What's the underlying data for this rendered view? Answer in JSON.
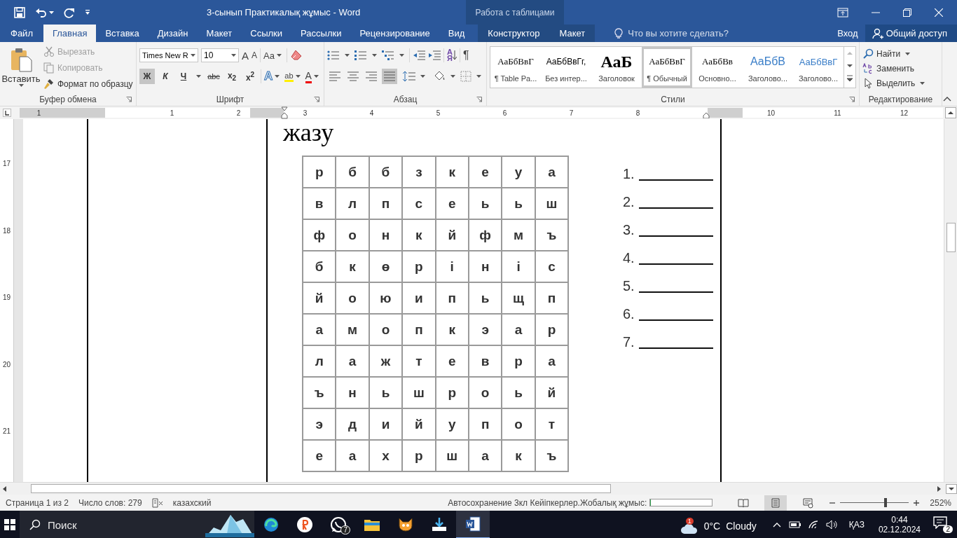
{
  "window": {
    "title": "3-сынып Практикалық жұмыс - Word",
    "context_group": "Работа с таблицами"
  },
  "tabs": [
    {
      "label": "Файл",
      "selected": false,
      "kind": "normal"
    },
    {
      "label": "Главная",
      "selected": true,
      "kind": "normal"
    },
    {
      "label": "Вставка",
      "selected": false,
      "kind": "normal"
    },
    {
      "label": "Дизайн",
      "selected": false,
      "kind": "normal"
    },
    {
      "label": "Макет",
      "selected": false,
      "kind": "normal"
    },
    {
      "label": "Ссылки",
      "selected": false,
      "kind": "normal"
    },
    {
      "label": "Рассылки",
      "selected": false,
      "kind": "normal"
    },
    {
      "label": "Рецензирование",
      "selected": false,
      "kind": "normal"
    },
    {
      "label": "Вид",
      "selected": false,
      "kind": "normal"
    },
    {
      "label": "Конструктор",
      "selected": false,
      "kind": "contextual"
    },
    {
      "label": "Макет",
      "selected": false,
      "kind": "contextual"
    }
  ],
  "tell_me": {
    "placeholder": "Что вы хотите сделать?"
  },
  "account": {
    "sign_in": "Вход",
    "share": "Общий доступ"
  },
  "clipboard": {
    "label": "Буфер обмена",
    "paste": "Вставить",
    "commands": [
      {
        "label": "Вырезать",
        "disabled": true,
        "kind": "cut"
      },
      {
        "label": "Копировать",
        "disabled": true,
        "kind": "copy"
      },
      {
        "label": "Формат по образцу",
        "disabled": false,
        "kind": "painter"
      }
    ]
  },
  "font": {
    "label": "Шрифт",
    "font_name": "Times New R",
    "font_size": "10",
    "grow": "A",
    "shrink": "A",
    "case": "Aa",
    "format_buttons": [
      {
        "label": "Ж",
        "selected": true,
        "kind": "bold"
      },
      {
        "label": "К",
        "selected": false,
        "kind": "italic"
      },
      {
        "label": "Ч",
        "selected": false,
        "kind": "underline"
      },
      {
        "label": "abc",
        "selected": false,
        "kind": "strike"
      },
      {
        "label": "x$_{2}$",
        "selected": false,
        "kind": "sub"
      },
      {
        "label": "x$^{2}$",
        "selected": false,
        "kind": "sup"
      }
    ],
    "effects": "A",
    "highlight": "ab",
    "font_color_letter": "A"
  },
  "paragraph": {
    "label": "Абзац",
    "sort": "АЯ",
    "pilcrow": "¶",
    "alignment": [
      {
        "kind": "left",
        "selected": false
      },
      {
        "kind": "center",
        "selected": false
      },
      {
        "kind": "right",
        "selected": false
      },
      {
        "kind": "justify",
        "selected": true
      }
    ]
  },
  "styles": {
    "label": "Стили",
    "items": [
      {
        "preview": "АаБбВвГ",
        "name": "¶ Table Pa...",
        "selected": false,
        "kind": "serif"
      },
      {
        "preview": "АаБбВвГг,",
        "name": "Без интер...",
        "selected": false,
        "kind": "sans"
      },
      {
        "preview": "АаБ",
        "name": "Заголовок",
        "selected": false,
        "kind": "title"
      },
      {
        "preview": "АаБбВвГ",
        "name": "¶ Обычный",
        "selected": true,
        "kind": "serif"
      },
      {
        "preview": "АаБбВв",
        "name": "Основно...",
        "selected": false,
        "kind": "serif"
      },
      {
        "preview": "АаБбВ",
        "name": "Заголово...",
        "selected": false,
        "kind": "heading1"
      },
      {
        "preview": "АаБбВвГ",
        "name": "Заголово...",
        "selected": false,
        "kind": "heading2"
      }
    ]
  },
  "editing": {
    "label": "Редактирование",
    "commands": [
      {
        "label": "Найти",
        "kind": "find"
      },
      {
        "label": "Заменить",
        "kind": "replace"
      },
      {
        "label": "Выделить",
        "kind": "select"
      }
    ]
  },
  "ruler": {
    "horizontal": [
      "1",
      "1",
      "2",
      "3",
      "4",
      "5",
      "6",
      "7",
      "8",
      "10",
      "11",
      "12"
    ],
    "vertical": [
      "17",
      "18",
      "19",
      "20",
      "21"
    ]
  },
  "document": {
    "heading": "жазу",
    "grid": [
      [
        "р",
        "б",
        "б",
        "з",
        "к",
        "е",
        "у",
        "а"
      ],
      [
        "в",
        "л",
        "п",
        "с",
        "е",
        "ь",
        "ь",
        "ш"
      ],
      [
        "ф",
        "о",
        "н",
        "к",
        "й",
        "ф",
        "м",
        "ъ"
      ],
      [
        "б",
        "к",
        "ө",
        "р",
        "і",
        "н",
        "і",
        "с"
      ],
      [
        "й",
        "о",
        "ю",
        "и",
        "п",
        "ь",
        "щ",
        "п"
      ],
      [
        "а",
        "м",
        "о",
        "п",
        "к",
        "э",
        "а",
        "р"
      ],
      [
        "л",
        "а",
        "ж",
        "т",
        "е",
        "в",
        "р",
        "а"
      ],
      [
        "ъ",
        "н",
        "ь",
        "ш",
        "р",
        "о",
        "ь",
        "й"
      ],
      [
        "э",
        "д",
        "и",
        "й",
        "у",
        "п",
        "о",
        "т"
      ],
      [
        "е",
        "а",
        "х",
        "р",
        "ш",
        "а",
        "к",
        "ъ"
      ]
    ],
    "answers": [
      "1.",
      "2.",
      "3.",
      "4.",
      "5.",
      "6.",
      "7."
    ]
  },
  "status_bar": {
    "page": "Страница 1 из 2",
    "words": "Число слов: 279",
    "language": "казахский",
    "autosave": "Автосохранение 3кл Кейіпкерлер.Жобалық жұмыс:",
    "autosave_progress": {
      "level": 0
    },
    "views": [
      {
        "kind": "read",
        "selected": false
      },
      {
        "kind": "print",
        "selected": true
      },
      {
        "kind": "web",
        "selected": false
      }
    ],
    "zoom": {
      "level": 0.66,
      "percent": "252%"
    }
  },
  "taskbar": {
    "search_placeholder": "Поиск",
    "apps": [
      {
        "kind": "edge",
        "selected": false
      },
      {
        "kind": "yandex",
        "selected": false
      },
      {
        "kind": "whatsapp",
        "selected": false,
        "badge": "7"
      },
      {
        "kind": "explorer",
        "selected": false
      },
      {
        "kind": "cat",
        "selected": false
      },
      {
        "kind": "download",
        "selected": false
      },
      {
        "kind": "word",
        "selected": true
      }
    ],
    "weather": {
      "badge": "1",
      "temperature": "0°C",
      "condition": "Cloudy"
    },
    "language": "ҚАЗ",
    "time": "0:44",
    "date": "02.12.2024",
    "notifications": "2"
  }
}
